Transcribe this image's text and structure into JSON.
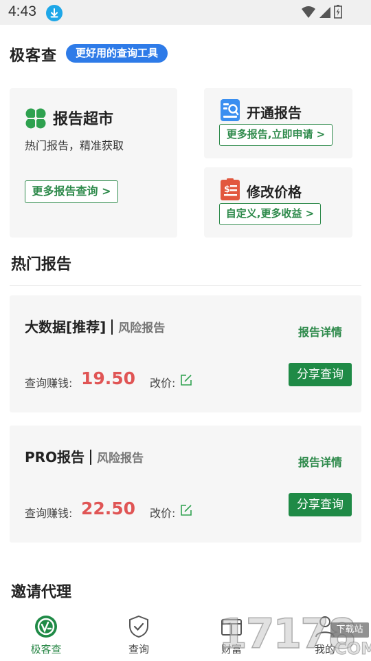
{
  "status_bar": {
    "time": "4:43",
    "icons": [
      "download-icon",
      "wifi-icon",
      "signal-icon",
      "battery-icon"
    ]
  },
  "header": {
    "title": "极客查",
    "slogan": "更好用的查询工具"
  },
  "features": {
    "market": {
      "title": "报告超市",
      "subtitle": "热门报告，精准获取",
      "button": "更多报告查询 >"
    },
    "open_report": {
      "title": "开通报告",
      "button": "更多报告,立即申请 >"
    },
    "change_price": {
      "title": "修改价格",
      "button": "自定义,更多收益 >"
    }
  },
  "hot_reports": {
    "title": "热门报告",
    "items": [
      {
        "name": "大数据[推荐]",
        "type": "风险报告",
        "detail_link": "报告详情",
        "earn_label": "查询赚钱:",
        "earn_value": "19.50",
        "change_label": "改价:",
        "share_button": "分享查询"
      },
      {
        "name": "PRO报告",
        "type": "风险报告",
        "detail_link": "报告详情",
        "earn_label": "查询赚钱:",
        "earn_value": "22.50",
        "change_label": "改价:",
        "share_button": "分享查询"
      }
    ]
  },
  "invite": {
    "title": "邀请代理"
  },
  "tabbar": {
    "items": [
      {
        "label": "极客查",
        "icon": "home-logo-icon",
        "active": true
      },
      {
        "label": "查询",
        "icon": "shield-check-icon",
        "active": false
      },
      {
        "label": "财富",
        "icon": "wallet-icon",
        "active": false
      },
      {
        "label": "我的",
        "icon": "user-icon",
        "active": false
      }
    ]
  },
  "watermark": {
    "digits": "17178",
    "tag": "下载站",
    "suffix": ".COM"
  },
  "colors": {
    "brand_green": "#2e8a4b",
    "share_green": "#1f8a46",
    "accent_blue": "#2e7be8",
    "price_red": "#e05555",
    "card_bg": "#f6f6f6"
  }
}
